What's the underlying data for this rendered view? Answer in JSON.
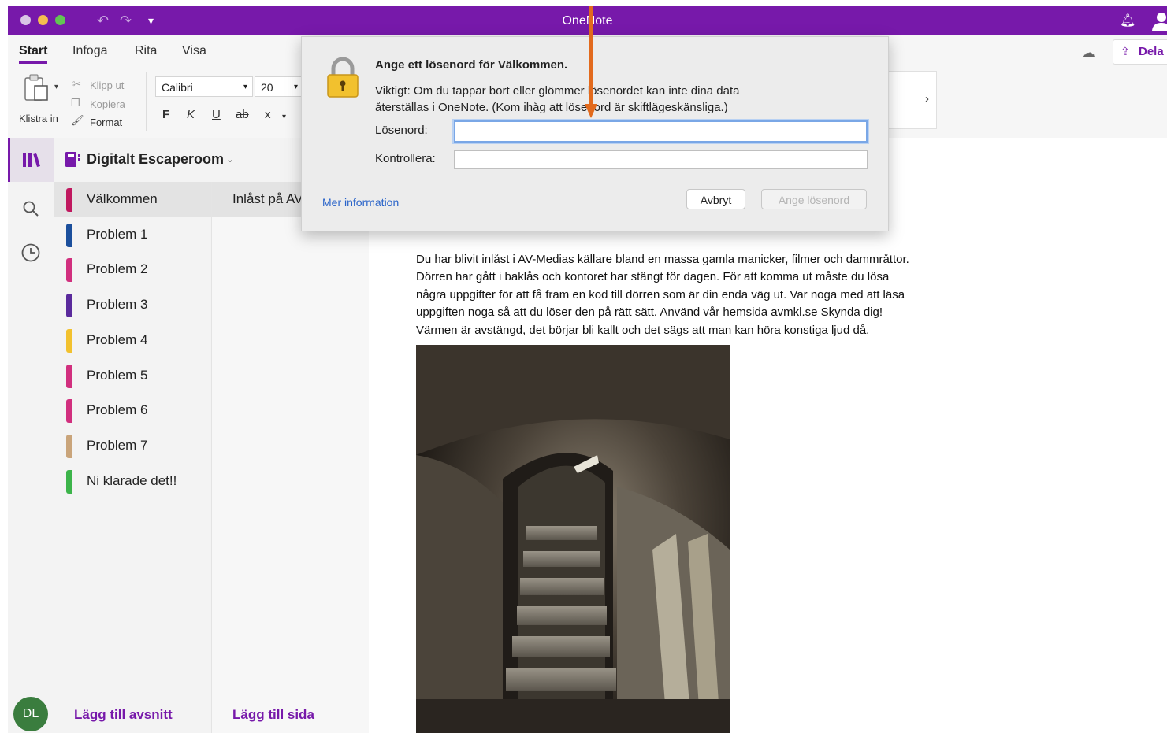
{
  "window": {
    "title": "OneNote",
    "traffic_lights": [
      "#ee6a5f",
      "#f5be4f",
      "#62c554"
    ],
    "accent_color": "#7719aa"
  },
  "ribbon": {
    "tabs": [
      {
        "label": "Start",
        "active": true
      },
      {
        "label": "Infoga",
        "active": false
      },
      {
        "label": "Rita",
        "active": false
      },
      {
        "label": "Visa",
        "active": false
      }
    ],
    "paste_label": "Klistra in",
    "cut_label": "Klipp ut",
    "copy_label": "Kopiera",
    "format_label": "Format",
    "font_name": "Calibri",
    "font_size": "20",
    "bold": "F",
    "italic": "K",
    "underline": "U",
    "strike": "ab",
    "subscript": "x",
    "share_label": "Dela",
    "expand_glyph": "›"
  },
  "notebook": {
    "name": "Digitalt Escaperoom"
  },
  "sections": [
    {
      "label": "Välkommen",
      "color": "#c0185f",
      "active": true
    },
    {
      "label": "Problem 1",
      "color": "#1b4f9c",
      "active": false
    },
    {
      "label": "Problem 2",
      "color": "#d12f7e",
      "active": false
    },
    {
      "label": "Problem 3",
      "color": "#5a2a9c",
      "active": false
    },
    {
      "label": "Problem 4",
      "color": "#f2c12e",
      "active": false
    },
    {
      "label": "Problem 5",
      "color": "#d12f7e",
      "active": false
    },
    {
      "label": "Problem 6",
      "color": "#d12f7e",
      "active": false
    },
    {
      "label": "Problem 7",
      "color": "#c9a47a",
      "active": false
    },
    {
      "label": "Ni klarade det!!",
      "color": "#3cb44a",
      "active": false
    }
  ],
  "pages": {
    "first_page": "Inlåst på AV"
  },
  "footer": {
    "avatar_initials": "DL",
    "add_section": "Lägg till avsnitt",
    "add_page": "Lägg till sida"
  },
  "note": {
    "lines": [
      "Du har blivit inlåst i AV-Medias källare bland en massa gamla manicker, filmer och dammråttor.",
      "Dörren har gått i baklås och kontoret har stängt för dagen. För att komma ut måste du lösa",
      "några uppgifter för att få fram en kod till dörren som är din enda väg ut. Var noga med att läsa",
      "uppgiften noga så att du löser den på rätt sätt. Använd vår hemsida avmkl.se  Skynda dig!",
      "Värmen är avstängd, det börjar bli kallt och det sägs att man kan höra konstiga ljud då."
    ]
  },
  "dialog": {
    "title": "Ange ett lösenord för Välkommen.",
    "message_line1": "Viktigt: Om du tappar bort eller glömmer lösenordet kan inte dina data",
    "message_line2": "återställas i OneNote. (Kom ihåg att lösenord är skiftlägeskänsliga.)",
    "password_label": "Lösenord:",
    "password_value": "",
    "verify_label": "Kontrollera:",
    "verify_value": "",
    "more_info": "Mer information",
    "cancel": "Avbryt",
    "confirm": "Ange lösenord"
  }
}
